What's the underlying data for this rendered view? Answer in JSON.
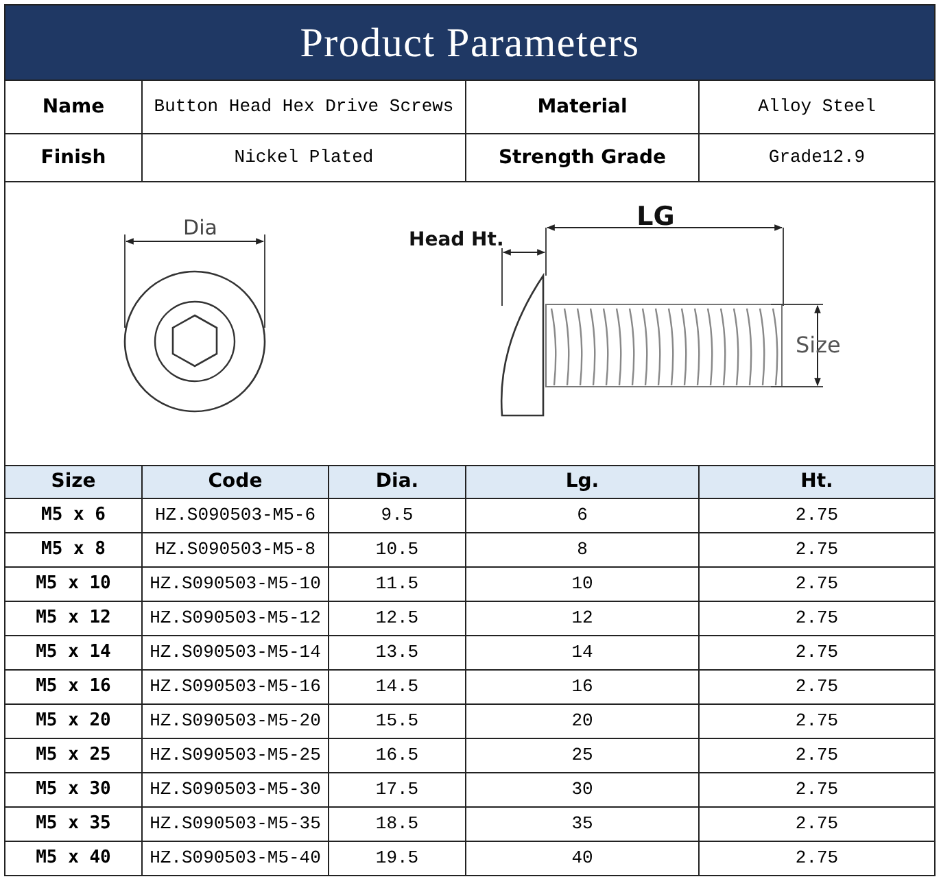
{
  "title": "Product Parameters",
  "specs": [
    {
      "label": "Name",
      "value": "Button Head Hex Drive Screws"
    },
    {
      "label": "Material",
      "value": "Alloy Steel"
    },
    {
      "label": "Finish",
      "value": "Nickel Plated"
    },
    {
      "label": "Strength Grade",
      "value": "Grade12.9"
    }
  ],
  "diagram": {
    "dia_label": "Dia",
    "head_label": "Head Ht.",
    "length_label": "LG",
    "size_label": "Size"
  },
  "table": {
    "columns": [
      "Size",
      "Code",
      "Dia.",
      "Lg.",
      "Ht."
    ],
    "rows": [
      [
        "M5 x 6",
        "HZ.S090503-M5-6",
        "9.5",
        "6",
        "2.75"
      ],
      [
        "M5 x 8",
        "HZ.S090503-M5-8",
        "10.5",
        "8",
        "2.75"
      ],
      [
        "M5 x 10",
        "HZ.S090503-M5-10",
        "11.5",
        "10",
        "2.75"
      ],
      [
        "M5 x 12",
        "HZ.S090503-M5-12",
        "12.5",
        "12",
        "2.75"
      ],
      [
        "M5 x 14",
        "HZ.S090503-M5-14",
        "13.5",
        "14",
        "2.75"
      ],
      [
        "M5 x 16",
        "HZ.S090503-M5-16",
        "14.5",
        "16",
        "2.75"
      ],
      [
        "M5 x 20",
        "HZ.S090503-M5-20",
        "15.5",
        "20",
        "2.75"
      ],
      [
        "M5 x 25",
        "HZ.S090503-M5-25",
        "16.5",
        "25",
        "2.75"
      ],
      [
        "M5 x 30",
        "HZ.S090503-M5-30",
        "17.5",
        "30",
        "2.75"
      ],
      [
        "M5 x 35",
        "HZ.S090503-M5-35",
        "18.5",
        "35",
        "2.75"
      ],
      [
        "M5 x 40",
        "HZ.S090503-M5-40",
        "19.5",
        "40",
        "2.75"
      ]
    ]
  }
}
